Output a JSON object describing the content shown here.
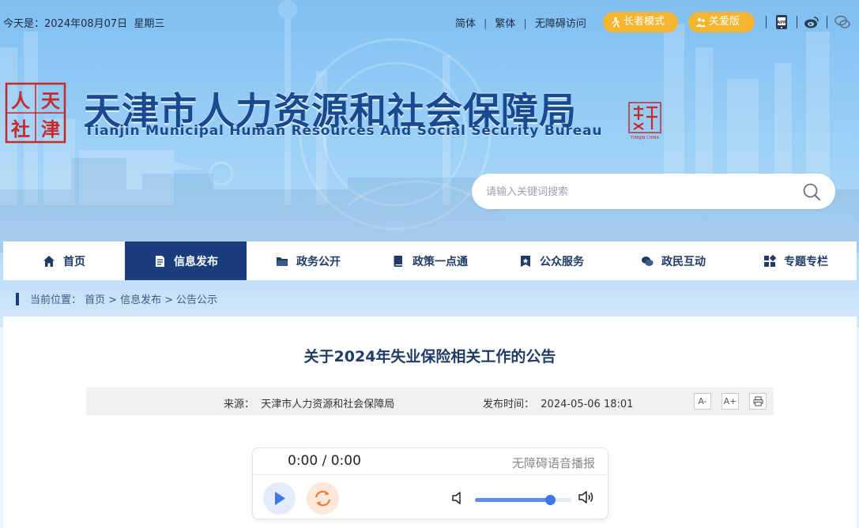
{
  "topbar": {
    "date_prefix": "今天是：",
    "date": "2024年08月07日",
    "weekday": "星期三",
    "lang_simplified": "简体",
    "lang_traditional": "繁体",
    "accessible": "无障碍访问",
    "elder_mode": "长者模式",
    "care_mode": "关爱版"
  },
  "header": {
    "title": "天津市人力资源和社会保障局",
    "subtitle": "Tianjin Municipal Human Resources And Social Security Bureau",
    "seal_chars": [
      "人",
      "天",
      "社",
      "津"
    ],
    "city_seal_text": "TIANJIN CHINA"
  },
  "search": {
    "placeholder": "请输入关键词搜索"
  },
  "nav": {
    "items": [
      {
        "label": "首页",
        "icon": "home-icon"
      },
      {
        "label": "信息发布",
        "icon": "document-icon",
        "active": true
      },
      {
        "label": "政务公开",
        "icon": "folder-icon"
      },
      {
        "label": "政策一点通",
        "icon": "book-icon"
      },
      {
        "label": "公众服务",
        "icon": "star-badge-icon"
      },
      {
        "label": "政民互动",
        "icon": "chat-icon"
      },
      {
        "label": "专题专栏",
        "icon": "grid-icon"
      }
    ]
  },
  "breadcrumb": {
    "prefix": "当前位置：",
    "items": [
      "首页",
      "信息发布",
      "公告公示"
    ],
    "sep": ">"
  },
  "article": {
    "title": "关于2024年失业保险相关工作的公告",
    "source_label": "来源：",
    "source": "天津市人力资源和社会保障局",
    "time_label": "发布时间：",
    "time": "2024-05-06 18:01",
    "font_smaller": "A-",
    "font_larger": "A+"
  },
  "player": {
    "time": "0:00 / 0:00",
    "label": "无障碍语音播报",
    "volume": 0.78
  },
  "colors": {
    "nav_active": "#1a3d7c",
    "title_blue": "#19498f",
    "pill_yellow": "#f6b531",
    "play_blue": "#3c78ea",
    "loop_orange": "#f07a3a"
  }
}
